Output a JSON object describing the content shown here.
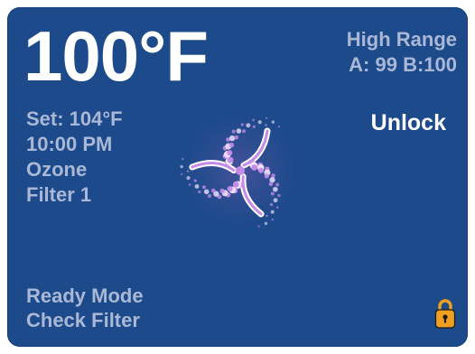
{
  "display": {
    "current_temp": "100°F",
    "range_label": "High Range",
    "sensor_readings": "A: 99 B:100",
    "unlock_label": "Unlock",
    "info": {
      "set_temp": "Set: 104°F",
      "time": "10:00 PM",
      "ozone": "Ozone",
      "filter": "Filter 1"
    },
    "status": {
      "mode": "Ready Mode",
      "message": "Check Filter"
    }
  },
  "icons": {
    "pinwheel": "pinwheel-icon",
    "lock": "lock-icon"
  },
  "colors": {
    "screen_background": "#1c4a8a",
    "primary_text": "#ffffff",
    "secondary_text": "#aab8d6",
    "pinwheel_accent": "#c58bea",
    "lock_color": "#f0a020"
  }
}
